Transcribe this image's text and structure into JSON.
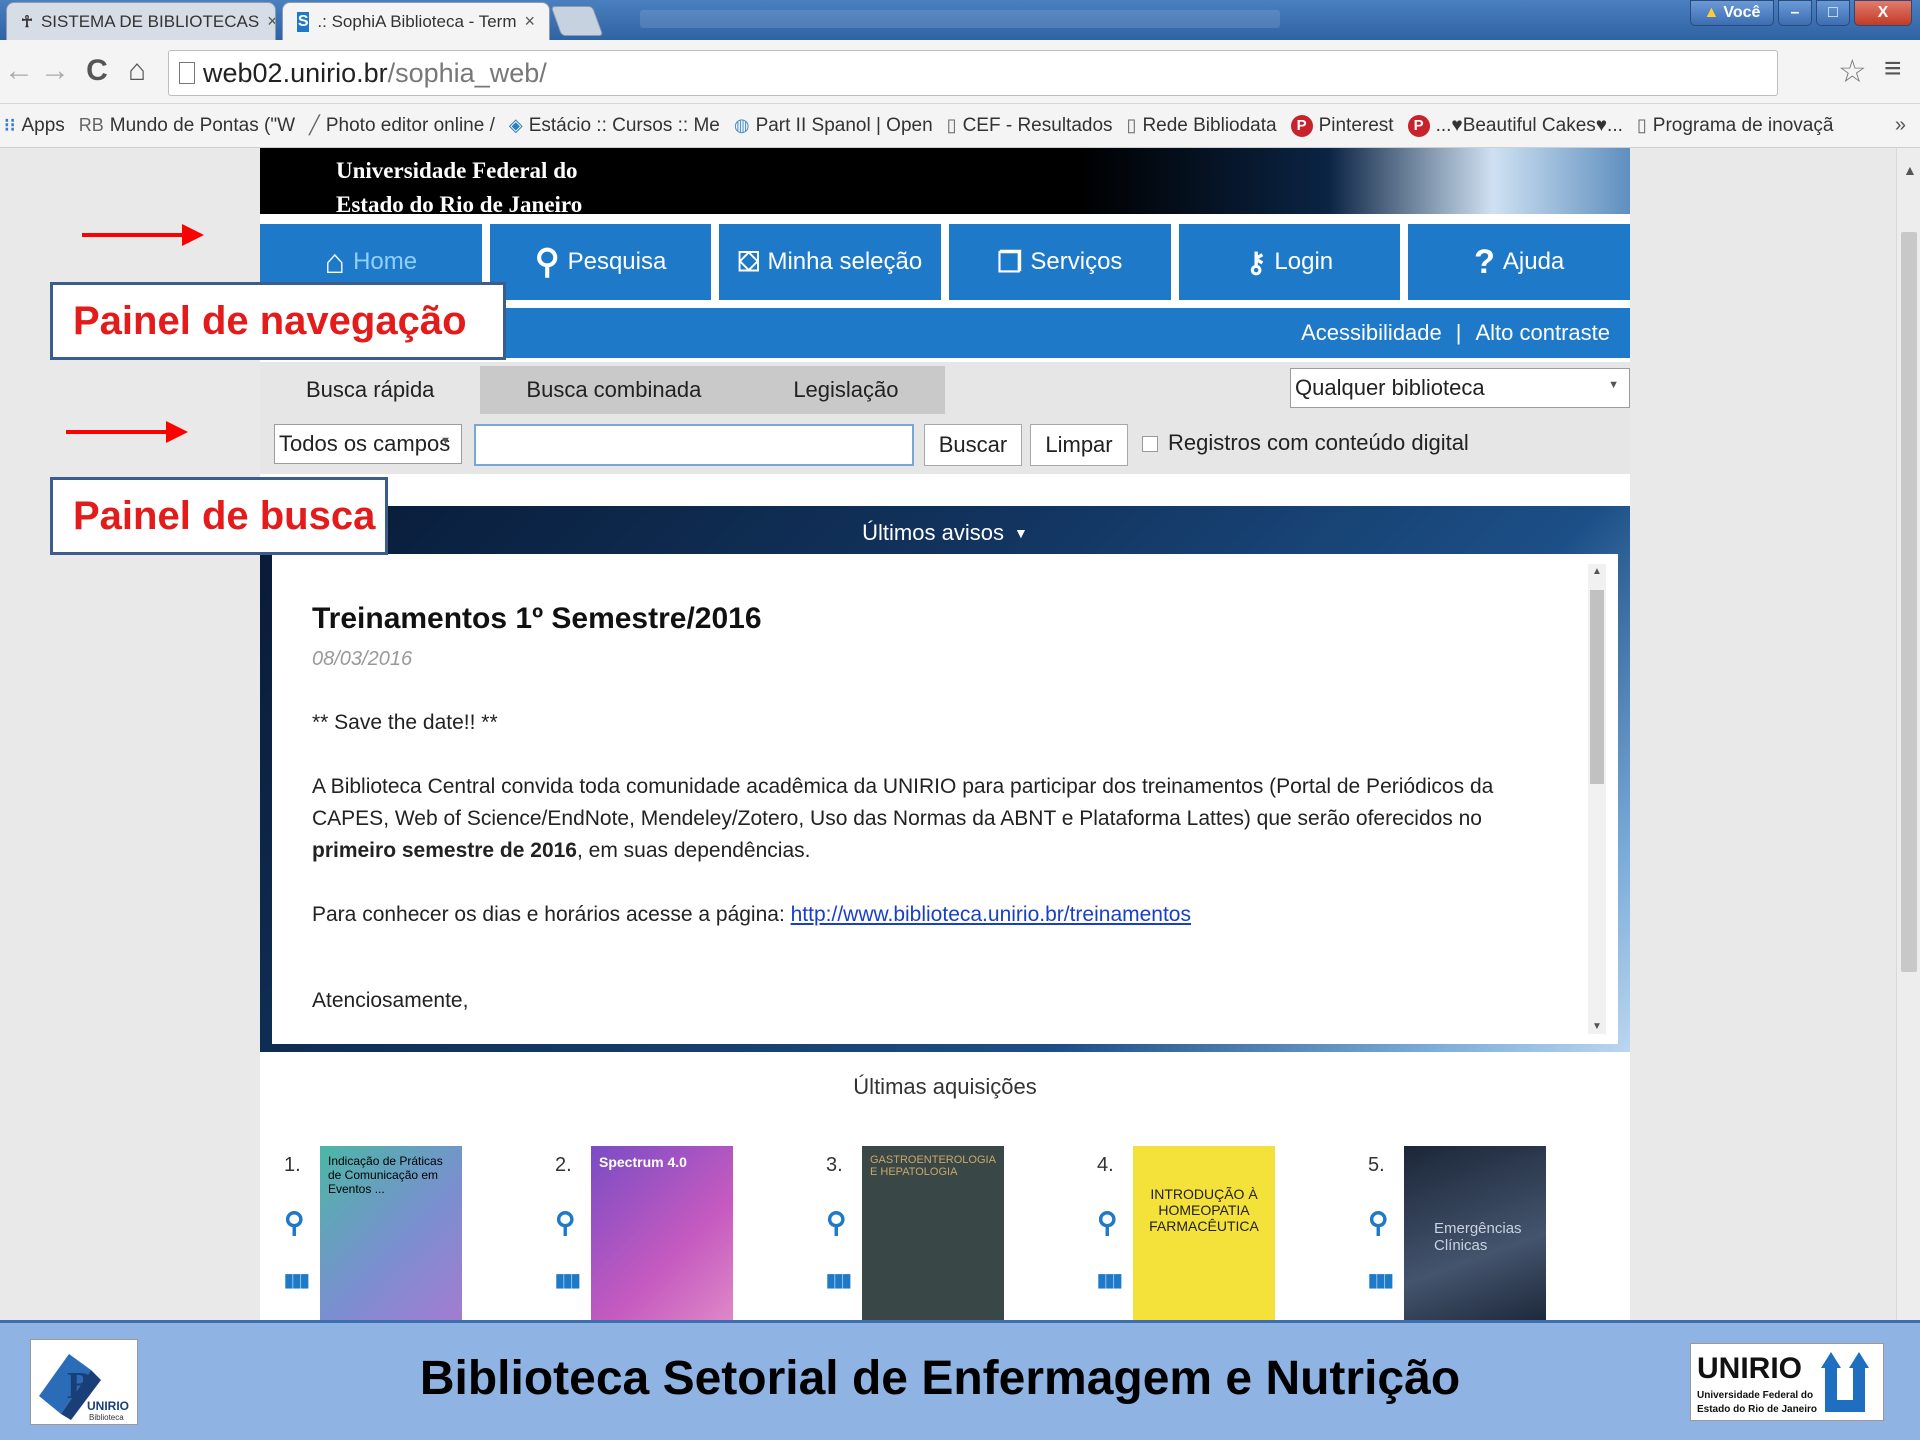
{
  "browser": {
    "tabs": [
      {
        "label": "SISTEMA DE BIBLIOTECAS",
        "active": false
      },
      {
        "label": ".: SophiA Biblioteca - Term",
        "active": true
      }
    ],
    "user_button": "Você",
    "window_controls": {
      "minimize": "–",
      "maximize": "□",
      "close": "X"
    },
    "address": {
      "host": "web02.unirio.br",
      "path": "/sophia_web/"
    },
    "bookmarks": [
      {
        "label": "Apps",
        "icon": "apps-grid-icon"
      },
      {
        "label": "Mundo de Pontas (\"W",
        "icon": "rb-icon"
      },
      {
        "label": "Photo editor online /",
        "icon": "pen-icon"
      },
      {
        "label": "Estácio :: Cursos :: Me",
        "icon": "diamond-icon"
      },
      {
        "label": "Part II Spanol | Open",
        "icon": "globe-icon"
      },
      {
        "label": "CEF - Resultados",
        "icon": "page-icon"
      },
      {
        "label": "Rede Bibliodata",
        "icon": "page-icon"
      },
      {
        "label": "Pinterest",
        "icon": "pinterest-icon"
      },
      {
        "label": "...♥Beautiful Cakes♥...",
        "icon": "pinterest-icon"
      },
      {
        "label": "Programa de inovaçã",
        "icon": "page-icon"
      }
    ],
    "bookmarks_more": "»"
  },
  "site": {
    "banner": [
      "Universidade Federal do",
      "Estado do Rio de Janeiro"
    ],
    "nav": [
      {
        "label": "Home",
        "icon": "home-icon"
      },
      {
        "label": "Pesquisa",
        "icon": "search-icon"
      },
      {
        "label": "Minha seleção",
        "icon": "basket-icon"
      },
      {
        "label": "Serviços",
        "icon": "services-icon"
      },
      {
        "label": "Login",
        "icon": "key-icon"
      },
      {
        "label": "Ajuda",
        "icon": "help-icon"
      }
    ],
    "accessibility": {
      "link1": "Acessibilidade",
      "sep": "|",
      "link2": "Alto contraste"
    },
    "search": {
      "tabs": [
        "Busca rápida",
        "Busca combinada",
        "Legislação"
      ],
      "library_select": "Qualquer biblioteca",
      "field_select": "Todos os campos",
      "query": "",
      "buttons": {
        "search": "Buscar",
        "clear": "Limpar"
      },
      "digital_only_label": "Registros com conteúdo digital",
      "digital_only_checked": false
    },
    "news": {
      "header": "Últimos avisos",
      "title": "Treinamentos 1º Semestre/2016",
      "date": "08/03/2016",
      "p1": "** Save the date!! **",
      "p2_a": "A Biblioteca Central convida toda comunidade acadêmica da UNIRIO para participar dos treinamentos (Portal de Periódicos da CAPES, Web of Science/EndNote, Mendeley/Zotero, Uso das Normas da ABNT e Plataforma Lattes) que serão oferecidos no ",
      "p2_bold": "primeiro semestre de 2016",
      "p2_b": ", em suas dependências.",
      "p3_text": "Para conhecer os dias e horários acesse a página: ",
      "p3_link": "http://www.biblioteca.unirio.br/treinamentos",
      "p4": "Atenciosamente,"
    },
    "acquisitions": {
      "title": "Últimas aquisições",
      "items": [
        {
          "num": "1.",
          "cover_text": "Indicação de Práticas de Comunicação em Eventos ...",
          "color": "#5fa8a0"
        },
        {
          "num": "2.",
          "cover_text": "Spectrum 4.0",
          "color": "#b04fc0"
        },
        {
          "num": "3.",
          "cover_text": "GASTROENTEROLOGIA E HEPATOLOGIA",
          "color": "#3a4a4a"
        },
        {
          "num": "4.",
          "cover_text": "INTRODUÇÃO À HOMEOPATIA FARMACÊUTICA",
          "color": "#f4e23a"
        },
        {
          "num": "5.",
          "cover_text": "Emergências Clínicas",
          "color": "#1d2a3e"
        }
      ]
    }
  },
  "annotations": {
    "nav_panel": "Painel de navegação",
    "search_panel": "Painel de busca"
  },
  "footer": {
    "title": "Biblioteca Setorial de Enfermagem e Nutrição",
    "logo_left": {
      "letter": "B",
      "line1": "UNIRIO",
      "line2": "Biblioteca"
    },
    "logo_right": {
      "name": "UNIRIO",
      "line1": "Universidade Federal do",
      "line2": "Estado do Rio de Janeiro"
    }
  },
  "colors": {
    "nav_blue": "#1e79c8",
    "annotation_red": "#ff0000",
    "footer_bg": "#8fb4e3"
  }
}
